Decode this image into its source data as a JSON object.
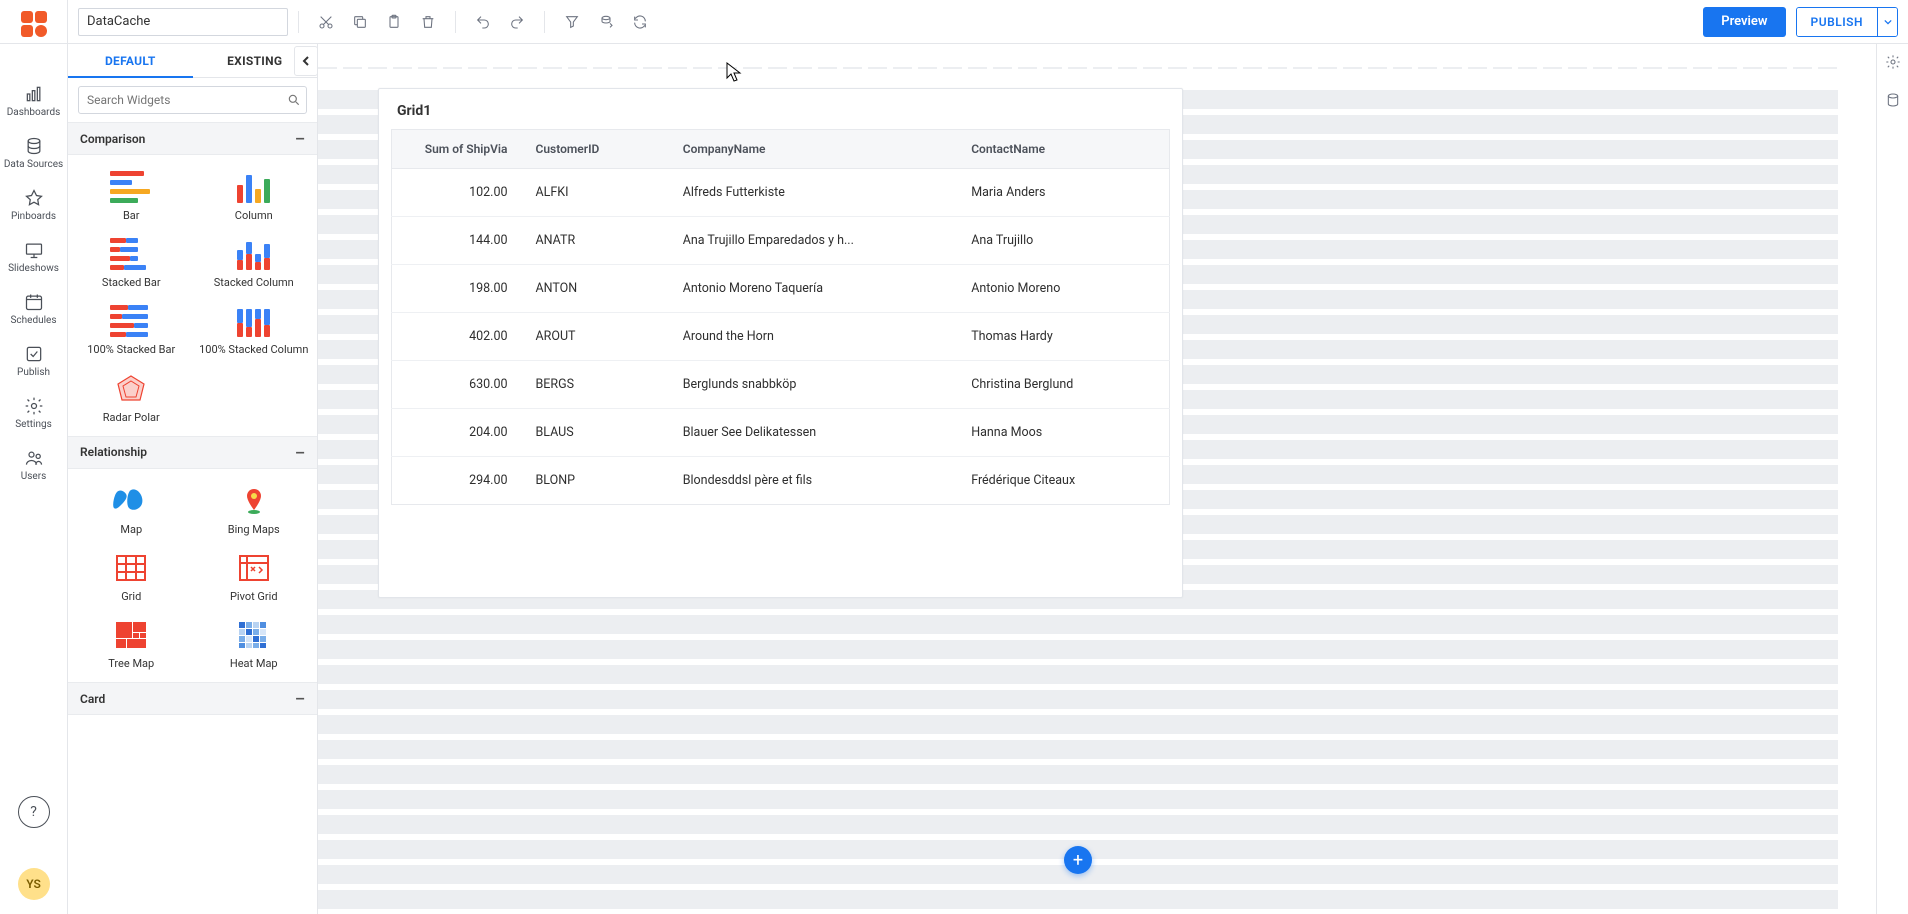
{
  "header": {
    "dashboard_name": "DataCache",
    "preview_label": "Preview",
    "publish_label": "PUBLISH"
  },
  "navrail": {
    "items": [
      {
        "label": "Dashboards"
      },
      {
        "label": "Data Sources"
      },
      {
        "label": "Pinboards"
      },
      {
        "label": "Slideshows"
      },
      {
        "label": "Schedules"
      },
      {
        "label": "Publish"
      },
      {
        "label": "Settings"
      },
      {
        "label": "Users"
      }
    ],
    "help_glyph": "?",
    "avatar_initials": "YS"
  },
  "palette": {
    "tabs": {
      "default": "DEFAULT",
      "existing": "EXISTING"
    },
    "search_placeholder": "Search Widgets",
    "groups": {
      "comparison": {
        "title": "Comparison",
        "toggle": "–"
      },
      "relationship": {
        "title": "Relationship",
        "toggle": "–"
      },
      "card": {
        "title": "Card",
        "toggle": "–"
      }
    },
    "widgets": {
      "bar": "Bar",
      "column": "Column",
      "stacked_bar": "Stacked Bar",
      "stacked_column": "Stacked Column",
      "hundred_stacked_bar": "100% Stacked Bar",
      "hundred_stacked_column": "100% Stacked Column",
      "radar": "Radar Polar",
      "map": "Map",
      "bing_maps": "Bing Maps",
      "grid": "Grid",
      "pivot_grid": "Pivot Grid",
      "tree_map": "Tree Map",
      "heat_map": "Heat Map"
    }
  },
  "grid_widget": {
    "title": "Grid1",
    "columns": [
      "Sum of ShipVia",
      "CustomerID",
      "CompanyName",
      "ContactName"
    ],
    "rows": [
      {
        "sum": "102.00",
        "cid": "ALFKI",
        "company": "Alfreds Futterkiste",
        "contact": "Maria Anders"
      },
      {
        "sum": "144.00",
        "cid": "ANATR",
        "company": "Ana Trujillo Emparedados y h...",
        "contact": "Ana Trujillo"
      },
      {
        "sum": "198.00",
        "cid": "ANTON",
        "company": "Antonio Moreno Taquería",
        "contact": "Antonio Moreno"
      },
      {
        "sum": "402.00",
        "cid": "AROUT",
        "company": "Around the Horn",
        "contact": "Thomas Hardy"
      },
      {
        "sum": "630.00",
        "cid": "BERGS",
        "company": "Berglunds snabbköp",
        "contact": "Christina Berglund"
      },
      {
        "sum": "204.00",
        "cid": "BLAUS",
        "company": "Blauer See Delikatessen",
        "contact": "Hanna Moos"
      },
      {
        "sum": "294.00",
        "cid": "BLONP",
        "company": "Blondesddsl père et fils",
        "contact": "Frédérique Citeaux"
      }
    ]
  },
  "colors": {
    "primary": "#1875f0",
    "accent_red": "#ee4331",
    "accent_blue": "#3b82f6",
    "accent_orange": "#f6a821",
    "accent_green": "#3cab5a"
  }
}
